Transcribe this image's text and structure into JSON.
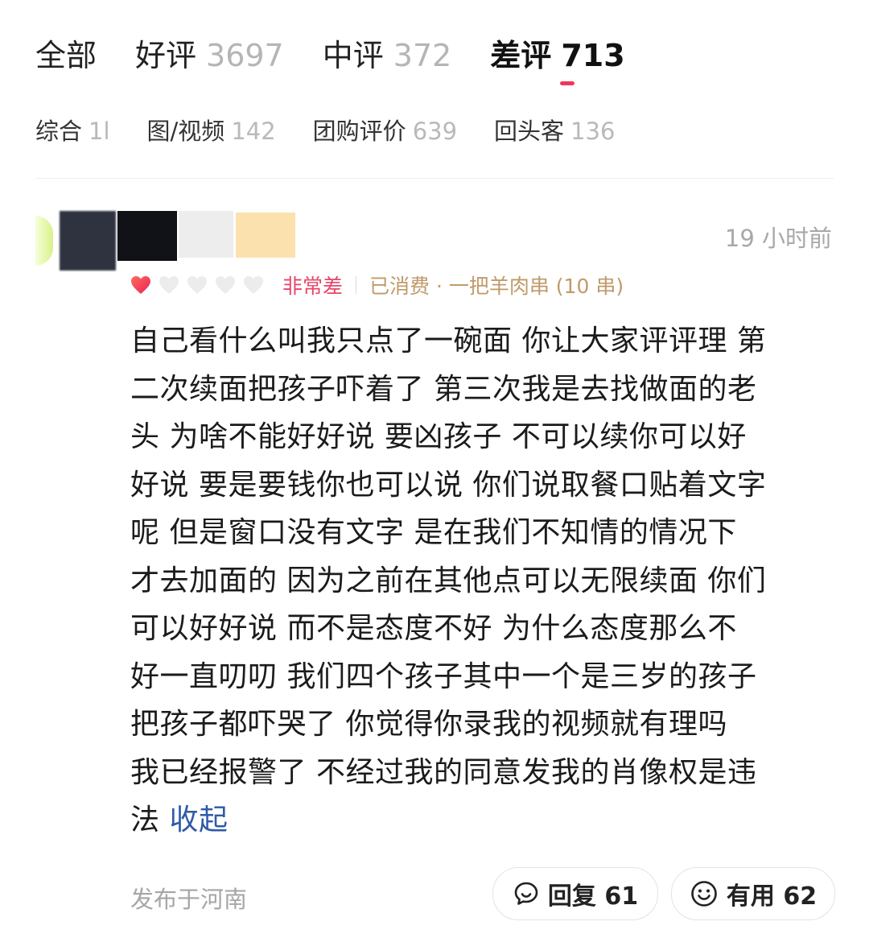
{
  "tabs": [
    {
      "label": "全部",
      "count": ""
    },
    {
      "label": "好评",
      "count": "3697"
    },
    {
      "label": "中评",
      "count": "372"
    },
    {
      "label": "差评",
      "count": "713"
    }
  ],
  "active_tab": "差评",
  "accent_color": "#f0365b",
  "filters": [
    {
      "label": "综合",
      "count": "1l"
    },
    {
      "label": "图/视频",
      "count": "142"
    },
    {
      "label": "团购评价",
      "count": "639"
    },
    {
      "label": "回头客",
      "count": "136"
    }
  ],
  "review": {
    "time": "19 小时前",
    "rating_stars": 1,
    "rating_max": 5,
    "rating_label": "非常差",
    "consumed": "已消费 · 一把羊肉串 (10 串)",
    "lines": [
      "自己看什么叫我只点了一碗面 你让大家评评理  第",
      "二次续面把孩子吓着了 第三次我是去找做面的老",
      "头 为啥不能好好说 要凶孩子  不可以续你可以好",
      "好说  要是要钱你也可以说 你们说取餐口贴着文字",
      "呢  但是窗口没有文字  是在我们不知情的情况下",
      "才去加面的  因为之前在其他点可以无限续面 你们",
      "可以好好说  而不是态度不好  为什么态度那么不",
      "好一直叨叨 我们四个孩子其中一个是三岁的孩子",
      "把孩子都吓哭了  你觉得你录我的视频就有理吗",
      "我已经报警了  不经过我的同意发我的肖像权是违"
    ],
    "last_line": "法",
    "collapse_label": "收起",
    "location": "发布于河南",
    "reply_label": "回复 61",
    "useful_label": "有用 62"
  }
}
